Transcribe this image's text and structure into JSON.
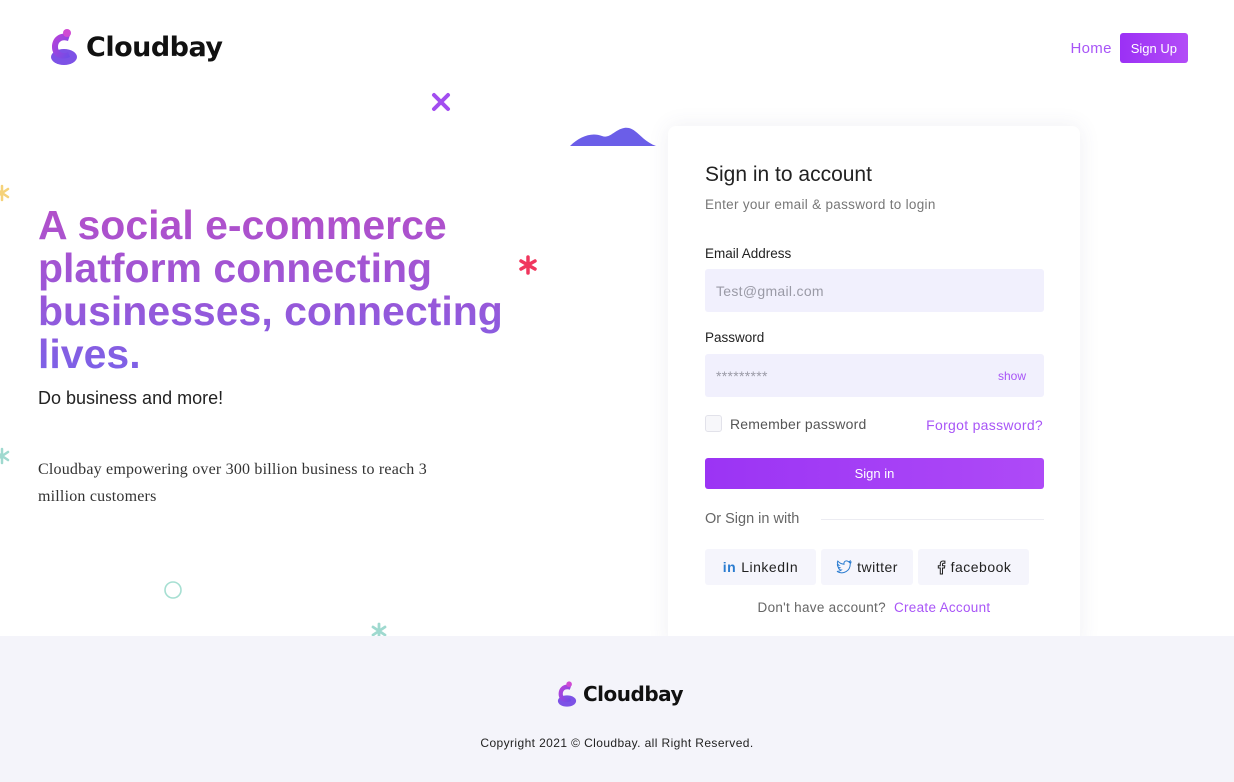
{
  "brand": {
    "name": "Cloudbay",
    "logo_icon": "cloud-c-logo-icon"
  },
  "nav": {
    "home_label": "Home",
    "signup_label": "Sign Up"
  },
  "hero": {
    "title": "A social e-commerce platform connecting businesses, connecting lives.",
    "subtitle": "Do business and more!",
    "description": "Cloudbay empowering over 300 billion business to reach 3 million customers"
  },
  "login": {
    "title": "Sign in to account",
    "subtitle": "Enter your email & password to login",
    "email_label": "Email Address",
    "email_placeholder": "Test@gmail.com",
    "password_label": "Password",
    "password_value": "*********",
    "show_label": "show",
    "remember_label": "Remember password",
    "forgot_label": "Forgot password?",
    "signin_label": "Sign in",
    "or_label": "Or Sign in with",
    "social": [
      {
        "label": "LinkedIn",
        "icon": "linkedin-icon"
      },
      {
        "label": "twitter",
        "icon": "twitter-icon"
      },
      {
        "label": "facebook",
        "icon": "facebook-icon"
      }
    ],
    "no_account_text": "Don't have account?",
    "create_account_label": "Create Account"
  },
  "footer": {
    "brand": "Cloudbay",
    "copyright": "Copyright 2021 © Cloudbay. all Right Reserved."
  },
  "colors": {
    "accent": "#a855f7",
    "button_start": "#9b34f4",
    "button_end": "#ae4af7",
    "footer_bg": "#f4f4fa",
    "input_bg": "#f1f0fd"
  }
}
